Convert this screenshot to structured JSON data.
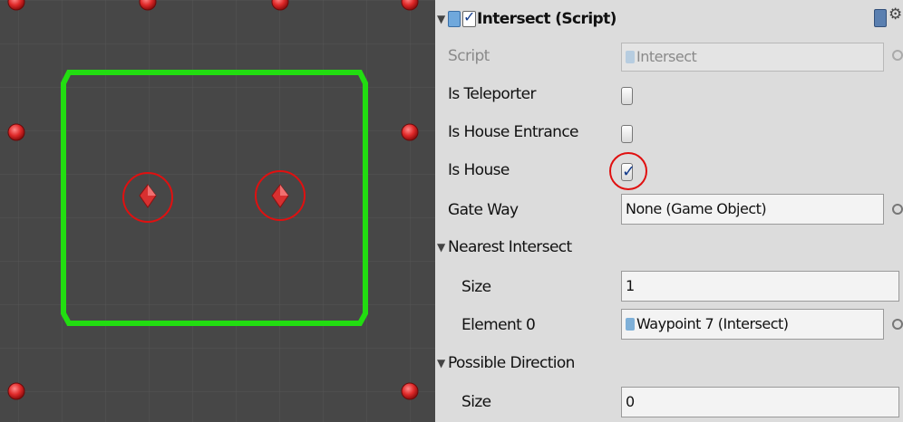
{
  "inspector": {
    "component_title": "Intersect (Script)",
    "component_enabled": true,
    "rows": {
      "script": {
        "label": "Script",
        "value": "Intersect"
      },
      "is_teleporter": {
        "label": "Is Teleporter",
        "checked": false
      },
      "is_house_entrance": {
        "label": "Is House Entrance",
        "checked": false
      },
      "is_house": {
        "label": "Is House",
        "checked": true
      },
      "gate_way": {
        "label": "Gate Way",
        "value": "None (Game Object)"
      },
      "nearest_intersect": {
        "label": "Nearest Intersect"
      },
      "nearest_size": {
        "label": "Size",
        "value": "1"
      },
      "element_0": {
        "label": "Element 0",
        "value": "Waypoint 7 (Intersect)"
      },
      "possible_direction": {
        "label": "Possible Direction"
      },
      "possible_size": {
        "label": "Size",
        "value": "0"
      }
    }
  },
  "colors": {
    "scene_background": "#474747",
    "house_outline": "#22dd11",
    "waypoint_dot": "#e03030",
    "annotation_circle": "#e01010",
    "inspector_background": "#dcdcdc"
  },
  "icons": [
    "help-book-icon",
    "gear-icon",
    "script-icon",
    "foldout-arrow-icon",
    "object-picker-icon",
    "checkbox-check-icon"
  ]
}
